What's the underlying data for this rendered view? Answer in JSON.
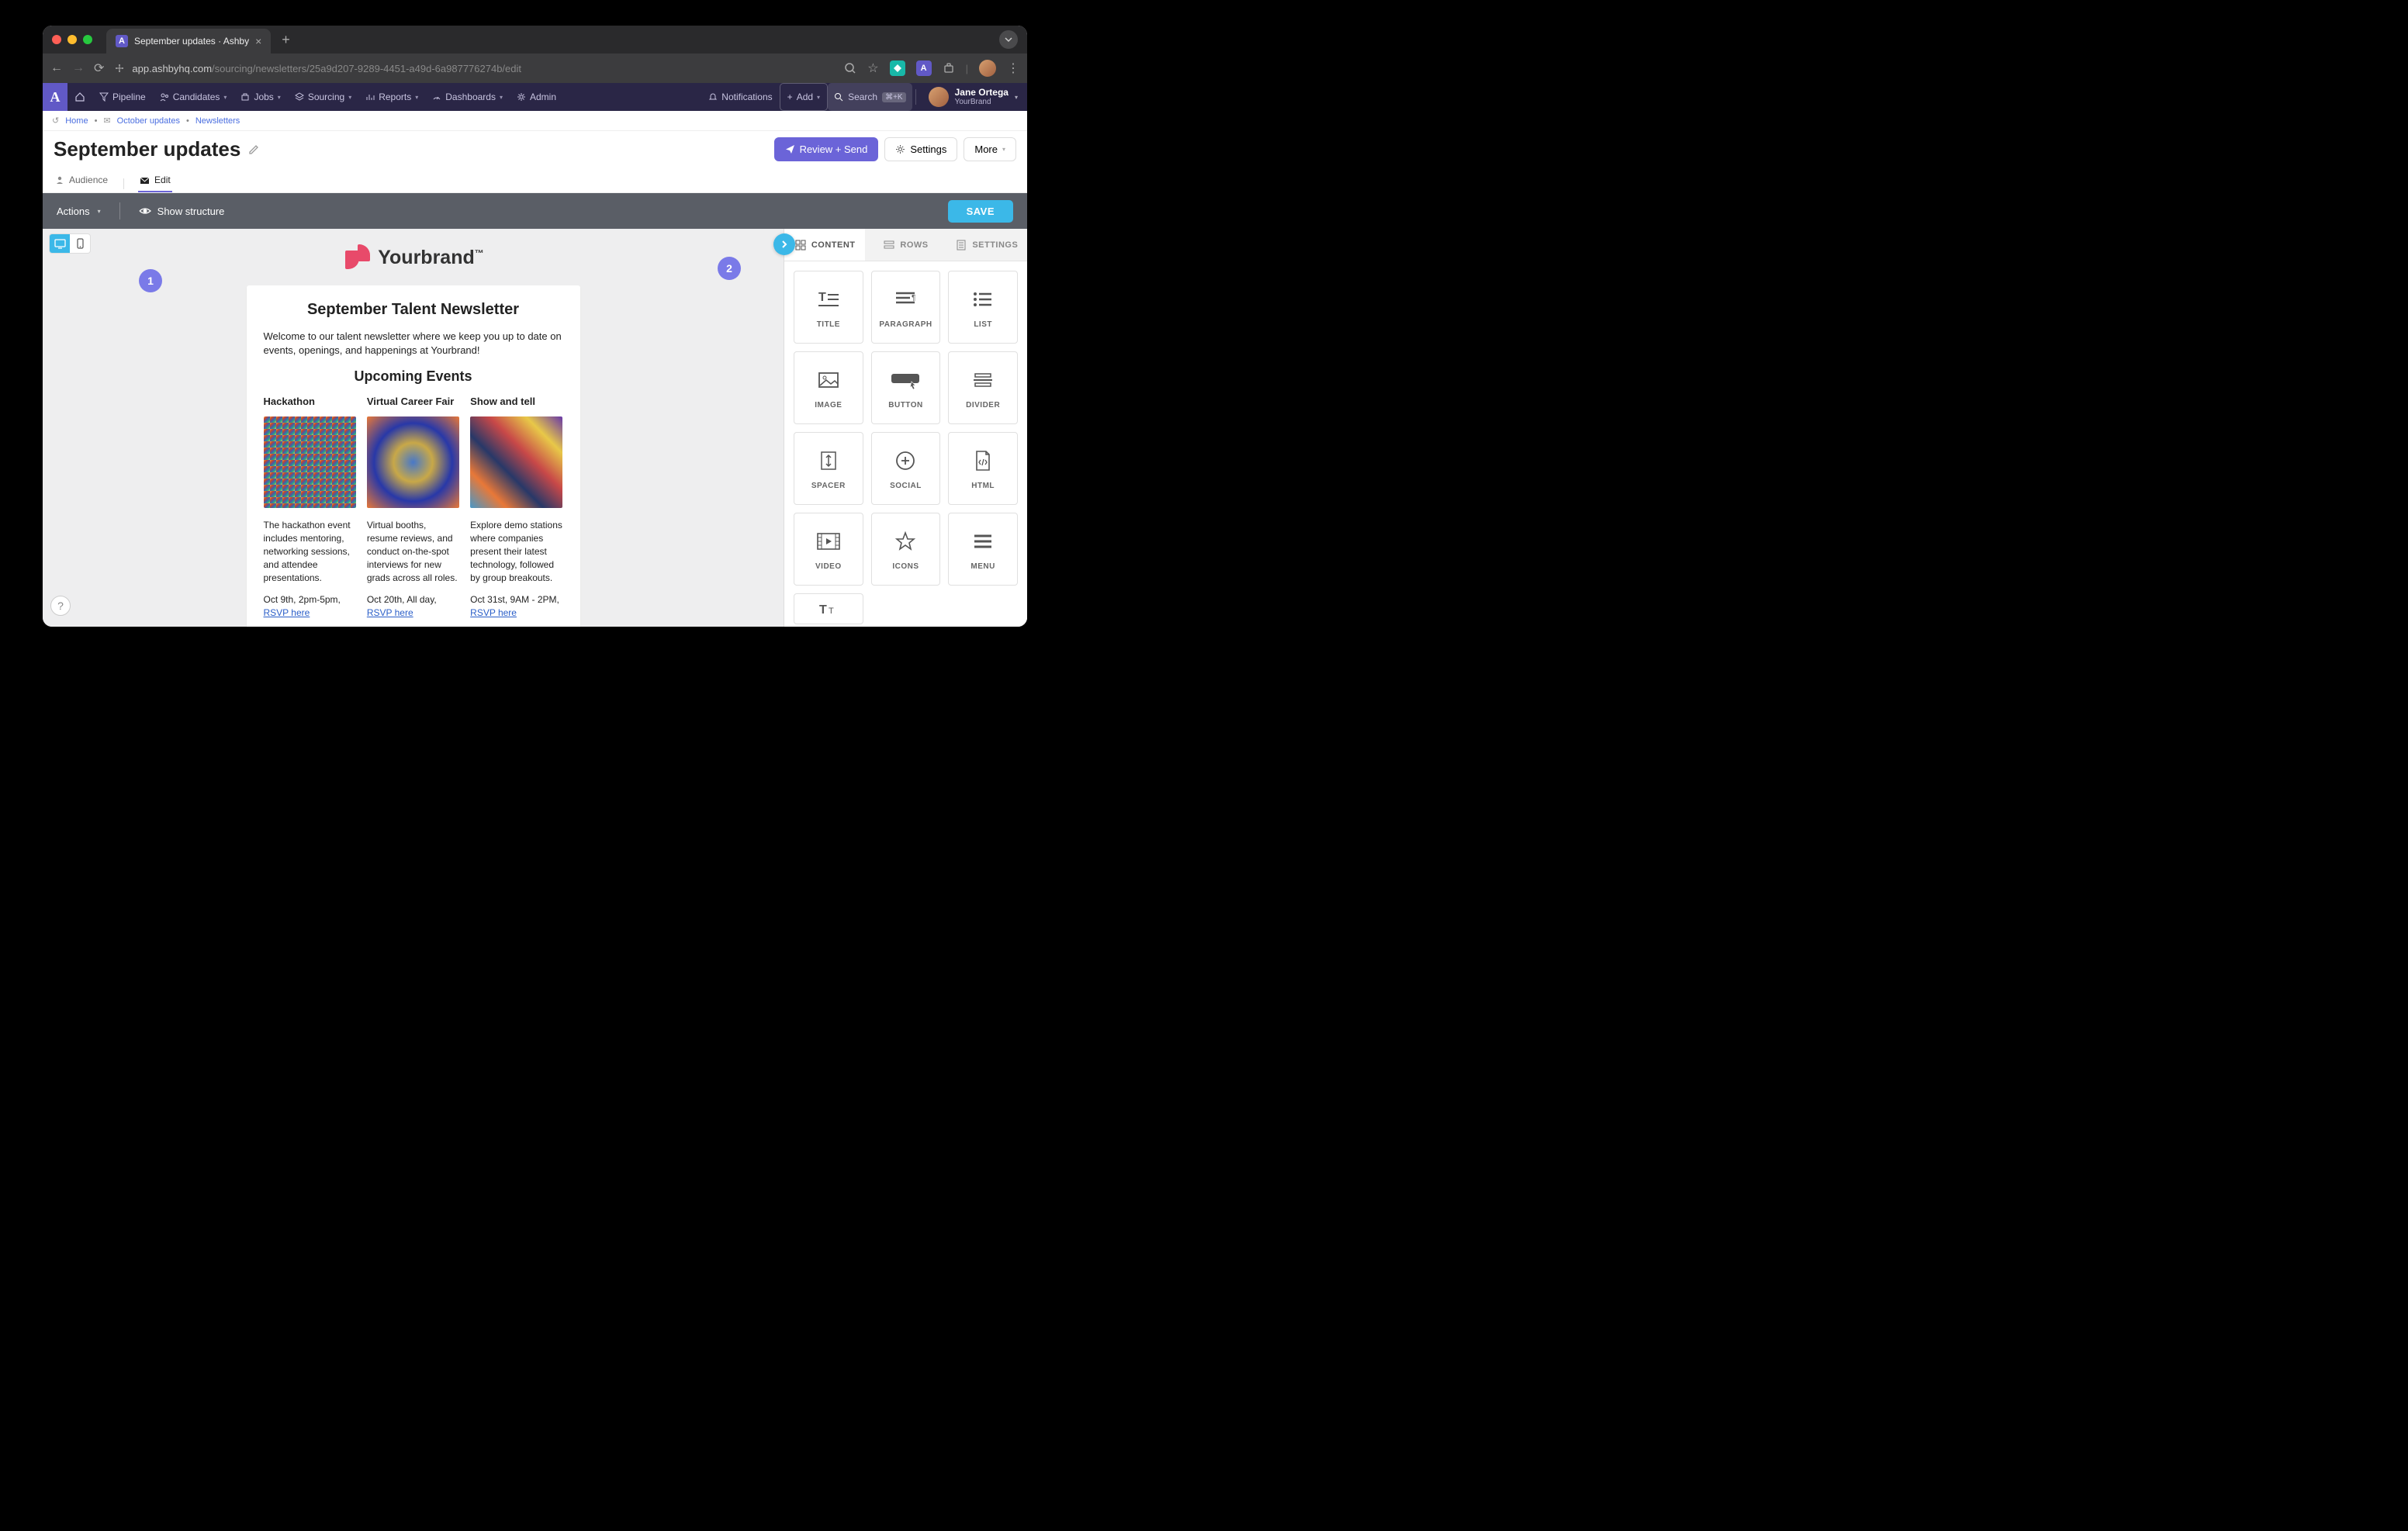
{
  "browser": {
    "tab_title": "September updates · Ashby",
    "url_host": "app.ashbyhq.com",
    "url_path": "/sourcing/newsletters/25a9d207-9289-4451-a49d-6a987776274b/edit"
  },
  "nav": {
    "items": [
      "Pipeline",
      "Candidates",
      "Jobs",
      "Sourcing",
      "Reports",
      "Dashboards",
      "Admin"
    ],
    "notifications": "Notifications",
    "add": "Add",
    "search": "Search",
    "search_kbd": "⌘+K",
    "user_name": "Jane Ortega",
    "user_org": "YourBrand"
  },
  "breadcrumb": {
    "home": "Home",
    "mid": "October updates",
    "leaf": "Newsletters"
  },
  "page": {
    "title": "September updates",
    "review_send": "Review + Send",
    "settings": "Settings",
    "more": "More",
    "tab_audience": "Audience",
    "tab_edit": "Edit"
  },
  "toolbar": {
    "actions": "Actions",
    "show_structure": "Show structure",
    "save": "SAVE"
  },
  "annotations": {
    "one": "1",
    "two": "2"
  },
  "newsletter": {
    "brand": "Yourbrand",
    "tm": "™",
    "heading": "September Talent Newsletter",
    "intro": "Welcome to our talent newsletter where we keep you up to date on events, openings, and happenings at Yourbrand!",
    "upcoming": "Upcoming Events",
    "events": [
      {
        "title": "Hackathon",
        "desc": "The hackathon event includes mentoring, networking sessions, and attendee presentations.",
        "when": "Oct 9th, 2pm-5pm, ",
        "rsvp": "RSVP here"
      },
      {
        "title": "Virtual Career Fair",
        "desc": "Virtual booths, resume reviews, and conduct on-the-spot interviews for new grads across all roles.",
        "when": "Oct 20th, All day, ",
        "rsvp": "RSVP here"
      },
      {
        "title": "Show and tell",
        "desc": "Explore demo stations where companies present their latest technology, followed by group breakouts.",
        "when": "Oct 31st, 9AM - 2PM, ",
        "rsvp": "RSVP here"
      }
    ]
  },
  "panel": {
    "tab_content": "CONTENT",
    "tab_rows": "ROWS",
    "tab_settings": "SETTINGS",
    "blocks": [
      "TITLE",
      "PARAGRAPH",
      "LIST",
      "IMAGE",
      "BUTTON",
      "DIVIDER",
      "SPACER",
      "SOCIAL",
      "HTML",
      "VIDEO",
      "ICONS",
      "MENU"
    ]
  }
}
